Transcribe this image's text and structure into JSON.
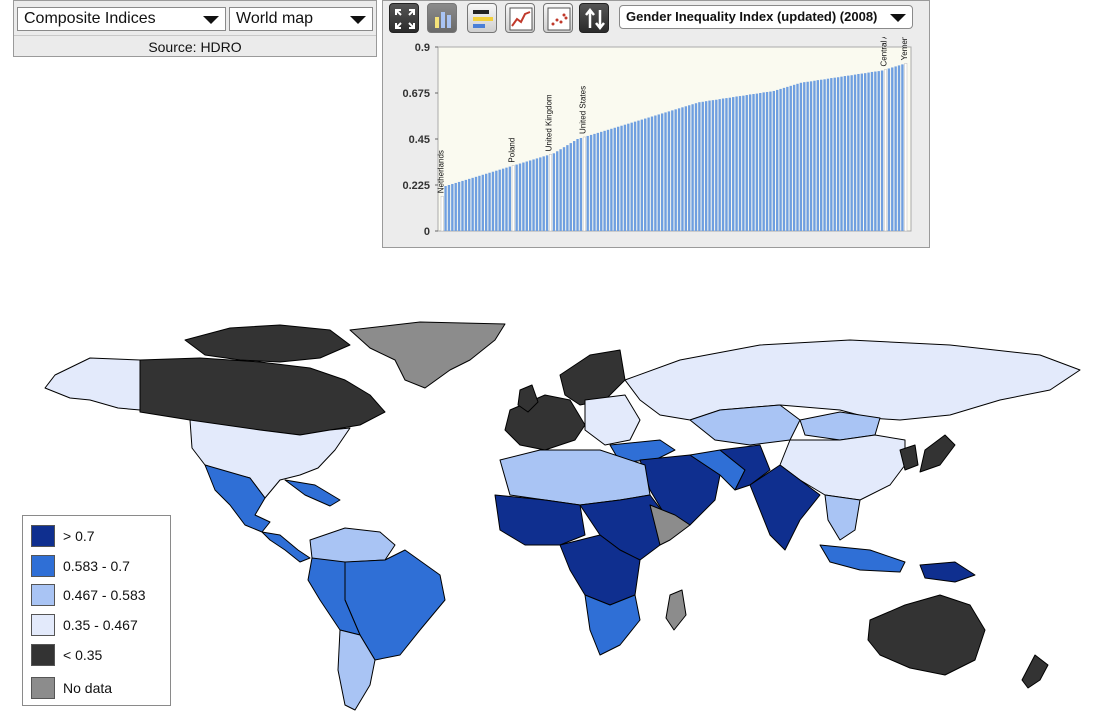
{
  "controls": {
    "category_select": "Composite Indices",
    "view_select": "World map",
    "source": "Source: HDRO"
  },
  "chart_toolbar": {
    "indicator_select": "Gender Inequality Index (updated) (2008)",
    "buttons": [
      "fullscreen-icon",
      "bar-chart-icon",
      "horizontal-bars-icon",
      "line-chart-icon",
      "scatter-icon",
      "sort-icon"
    ]
  },
  "chart_data": {
    "type": "bar",
    "title": "",
    "xlabel": "",
    "ylabel": "",
    "ylim": [
      0,
      0.9
    ],
    "yticks": [
      "0.9",
      "0.675",
      "0.45",
      "0.225",
      "0"
    ],
    "bar_color": "#6f9fe0",
    "highlight_color": "#ffffff",
    "count": 138,
    "values_sorted_ascending": [
      0.17,
      0.22,
      0.225,
      0.23,
      0.235,
      0.24,
      0.245,
      0.25,
      0.255,
      0.26,
      0.265,
      0.27,
      0.275,
      0.28,
      0.285,
      0.29,
      0.295,
      0.3,
      0.305,
      0.31,
      0.315,
      0.32,
      0.325,
      0.33,
      0.335,
      0.34,
      0.345,
      0.35,
      0.355,
      0.36,
      0.365,
      0.37,
      0.375,
      0.38,
      0.39,
      0.4,
      0.41,
      0.42,
      0.43,
      0.44,
      0.45,
      0.455,
      0.46,
      0.465,
      0.47,
      0.475,
      0.48,
      0.485,
      0.49,
      0.495,
      0.5,
      0.505,
      0.51,
      0.515,
      0.52,
      0.525,
      0.53,
      0.535,
      0.54,
      0.545,
      0.55,
      0.555,
      0.56,
      0.565,
      0.57,
      0.575,
      0.58,
      0.585,
      0.59,
      0.595,
      0.6,
      0.605,
      0.61,
      0.615,
      0.62,
      0.625,
      0.63,
      0.632,
      0.635,
      0.638,
      0.64,
      0.642,
      0.645,
      0.648,
      0.65,
      0.652,
      0.655,
      0.658,
      0.66,
      0.662,
      0.665,
      0.668,
      0.67,
      0.672,
      0.675,
      0.678,
      0.68,
      0.682,
      0.685,
      0.69,
      0.695,
      0.7,
      0.705,
      0.71,
      0.715,
      0.72,
      0.725,
      0.728,
      0.73,
      0.732,
      0.735,
      0.738,
      0.74,
      0.742,
      0.745,
      0.748,
      0.75,
      0.752,
      0.755,
      0.758,
      0.76,
      0.762,
      0.765,
      0.768,
      0.77,
      0.772,
      0.775,
      0.778,
      0.78,
      0.782,
      0.785,
      0.79,
      0.795,
      0.8,
      0.805,
      0.81,
      0.815,
      0.82
    ],
    "labeled_countries": [
      {
        "name": "Netherlands",
        "index": 0
      },
      {
        "name": "Poland",
        "index": 21
      },
      {
        "name": "United Kingdom",
        "index": 32
      },
      {
        "name": "United States",
        "index": 42
      },
      {
        "name": "Central African Republic",
        "index": 131
      },
      {
        "name": "Yemen",
        "index": 137
      }
    ]
  },
  "legend": {
    "items": [
      {
        "label": "> 0.7",
        "color": "#0f2f8f"
      },
      {
        "label": "0.583 - 0.7",
        "color": "#2f6fd6"
      },
      {
        "label": "0.467 - 0.583",
        "color": "#a9c4f4"
      },
      {
        "label": "0.35 - 0.467",
        "color": "#e3eafb"
      },
      {
        "label": "< 0.35",
        "color": "#333333"
      },
      {
        "label": "No data",
        "color": "#8c8c8c"
      }
    ]
  },
  "map": {
    "projection": "world map",
    "ocean_color": "#ffffff",
    "border_color": "#000000"
  }
}
